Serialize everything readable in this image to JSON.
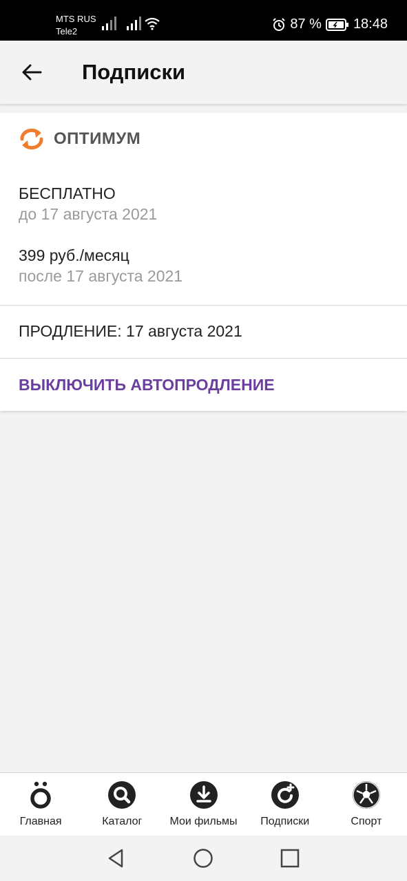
{
  "status_bar": {
    "carrier_1": "MTS RUS",
    "carrier_2": "Tele2",
    "battery": "87 %",
    "time": "18:48"
  },
  "header": {
    "title": "Подписки"
  },
  "subscription": {
    "plan_name": "ОПТИМУМ",
    "accent_color": "#ef7d2d",
    "free_label": "БЕСПЛАТНО",
    "free_until": "до 17 августа 2021",
    "price": "399 руб./месяц",
    "price_after": "после 17 августа 2021",
    "renewal": "ПРОДЛЕНИЕ: 17 августа 2021",
    "disable_autorenew": "ВЫКЛЮЧИТЬ АВТОПРОДЛЕНИЕ",
    "action_color": "#6a3fa0"
  },
  "bottom_nav": {
    "items": [
      {
        "label": "Главная",
        "icon": "home-logo-icon"
      },
      {
        "label": "Каталог",
        "icon": "search-icon"
      },
      {
        "label": "Мои фильмы",
        "icon": "download-icon"
      },
      {
        "label": "Подписки",
        "icon": "subscriptions-icon"
      },
      {
        "label": "Спорт",
        "icon": "soccer-ball-icon"
      }
    ]
  }
}
